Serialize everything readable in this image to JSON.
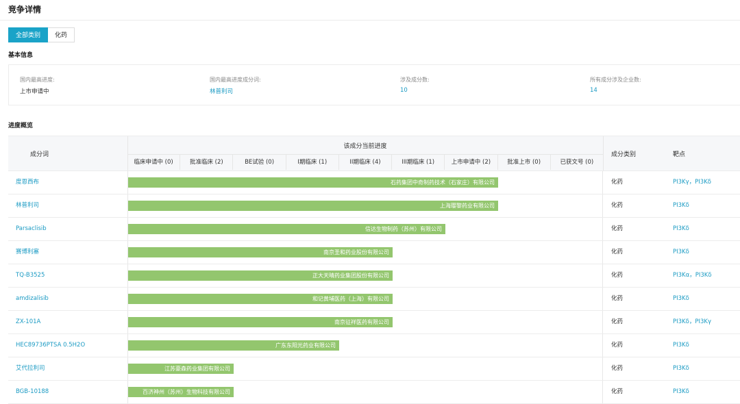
{
  "page_title": "竞争详情",
  "tabs": [
    {
      "label": "全部类别",
      "active": true
    },
    {
      "label": "化药",
      "active": false
    }
  ],
  "basic_info": {
    "section_title": "基本信息",
    "items": [
      {
        "label": "国内最高进度:",
        "value": "上市申请中",
        "link": false
      },
      {
        "label": "国内最高进度成分词:",
        "value": "林普利司",
        "link": true
      },
      {
        "label": "涉及成分数:",
        "value": "10",
        "link": true
      },
      {
        "label": "所有成分涉及企业数:",
        "value": "14",
        "link": true
      }
    ]
  },
  "progress": {
    "section_title": "进度概览",
    "headers": {
      "name": "成分词",
      "stage_group": "该成分当前进度",
      "type": "成分类别",
      "target": "靶点"
    },
    "stages": [
      "临床申请中 (0)",
      "批准临床 (2)",
      "BE试验 (0)",
      "I期临床 (1)",
      "II期临床 (4)",
      "III期临床 (1)",
      "上市申请中 (2)",
      "批准上市 (0)",
      "已获文号 (0)"
    ],
    "rows": [
      {
        "name": "度恩西布",
        "stage_level": 7,
        "company": "石药集团中奇制药技术（石家庄）有限公司",
        "type": "化药",
        "targets": [
          "PI3Kγ",
          "PI3Kδ"
        ]
      },
      {
        "name": "林普利司",
        "stage_level": 7,
        "company": "上海璎黎药业有限公司",
        "type": "化药",
        "targets": [
          "PI3Kδ"
        ]
      },
      {
        "name": "Parsaclisib",
        "stage_level": 6,
        "company": "信达生物制药（苏州）有限公司",
        "type": "化药",
        "targets": [
          "PI3Kδ"
        ]
      },
      {
        "name": "赛博利塞",
        "stage_level": 5,
        "company": "南京圣和药业股份有限公司",
        "type": "化药",
        "targets": [
          "PI3Kδ"
        ]
      },
      {
        "name": "TQ-B3525",
        "stage_level": 5,
        "company": "正大天晴药业集团股份有限公司",
        "type": "化药",
        "targets": [
          "PI3Kα",
          "PI3Kδ"
        ]
      },
      {
        "name": "amdizalisib",
        "stage_level": 5,
        "company": "和记黄埔医药（上海）有限公司",
        "type": "化药",
        "targets": [
          "PI3Kδ"
        ]
      },
      {
        "name": "ZX-101A",
        "stage_level": 5,
        "company": "南京征祥医药有限公司",
        "type": "化药",
        "targets": [
          "PI3Kδ",
          "PI3Kγ"
        ]
      },
      {
        "name": "HEC89736PTSA 0.5H2O",
        "stage_level": 4,
        "company": "广东东阳光药业有限公司",
        "type": "化药",
        "targets": [
          "PI3Kδ"
        ]
      },
      {
        "name": "艾代拉利司",
        "stage_level": 2,
        "company": "江苏豪森药业集团有限公司",
        "type": "化药",
        "targets": [
          "PI3Kδ"
        ]
      },
      {
        "name": "BGB-10188",
        "stage_level": 2,
        "company": "百济神州（苏州）生物科技有限公司",
        "type": "化药",
        "targets": [
          "PI3Kδ"
        ]
      }
    ],
    "target_separator": "，"
  },
  "colors": {
    "accent": "#1aa3c8",
    "link": "#1a9ac3",
    "bar": "#93c66e"
  }
}
